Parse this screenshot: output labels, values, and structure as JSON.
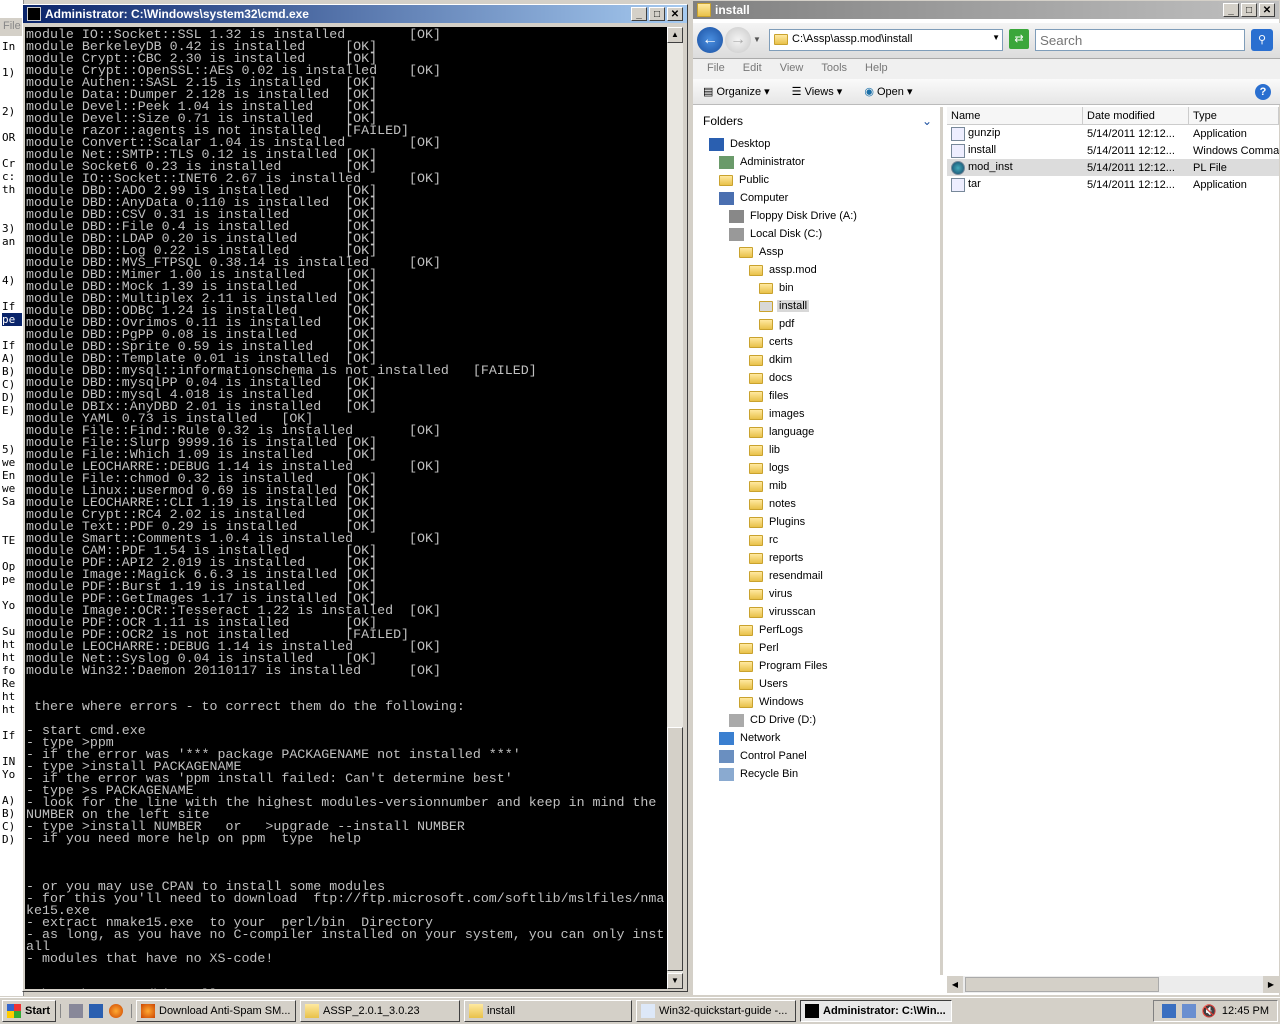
{
  "notepad": {
    "menu": "File",
    "lines": [
      "In",
      "",
      "1)",
      "",
      "",
      "2)",
      "",
      "OR",
      "",
      "Cr",
      "c:",
      "th",
      "",
      "",
      "3)",
      "an",
      "",
      "",
      "4)",
      "",
      "If",
      "pe",
      "",
      "If",
      "A)",
      "B)",
      "C)",
      "D)",
      "E)",
      "",
      "",
      "5)",
      "we",
      "En",
      "we",
      "Sa",
      "",
      "",
      "TE",
      "",
      "Op",
      "pe",
      "",
      "Yo",
      "",
      "Su",
      "ht",
      "ht",
      "fo",
      "Re",
      "ht",
      "ht",
      "",
      "If",
      "",
      "IN",
      "Yo",
      "",
      "A)",
      "B)",
      "C)",
      "D)"
    ],
    "selected_index": 21
  },
  "cmd": {
    "title": "Administrator: C:\\Windows\\system32\\cmd.exe",
    "lines": [
      "module IO::Socket::SSL 1.32 is installed\t[OK]",
      "module BerkeleyDB 0.42 is installed\t[OK]",
      "module Crypt::CBC 2.30 is installed\t[OK]",
      "module Crypt::OpenSSL::AES 0.02 is installed\t[OK]",
      "module Authen::SASL 2.15 is installed\t[OK]",
      "module Data::Dumper 2.128 is installed\t[OK]",
      "module Devel::Peek 1.04 is installed\t[OK]",
      "module Devel::Size 0.71 is installed\t[OK]",
      "module razor::agents is not installed\t[FAILED]",
      "module Convert::Scalar 1.04 is installed\t[OK]",
      "module Net::SMTP::TLS 0.12 is installed\t[OK]",
      "module Socket6 0.23 is installed\t[OK]",
      "module IO::Socket::INET6 2.67 is installed\t[OK]",
      "module DBD::ADO 2.99 is installed\t[OK]",
      "module DBD::AnyData 0.110 is installed\t[OK]",
      "module DBD::CSV 0.31 is installed\t[OK]",
      "module DBD::File 0.4 is installed\t[OK]",
      "module DBD::LDAP 0.20 is installed\t[OK]",
      "module DBD::Log 0.22 is installed\t[OK]",
      "module DBD::MVS_FTPSQL 0.38.14 is installed\t[OK]",
      "module DBD::Mimer 1.00 is installed\t[OK]",
      "module DBD::Mock 1.39 is installed\t[OK]",
      "module DBD::Multiplex 2.11 is installed\t[OK]",
      "module DBD::ODBC 1.24 is installed\t[OK]",
      "module DBD::Ovrimos 0.11 is installed\t[OK]",
      "module DBD::PgPP 0.08 is installed\t[OK]",
      "module DBD::Sprite 0.59 is installed\t[OK]",
      "module DBD::Template 0.01 is installed\t[OK]",
      "module DBD::mysql::informationschema is not installed\t[FAILED]",
      "module DBD::mysqlPP 0.04 is installed\t[OK]",
      "module DBD::mysql 4.018 is installed\t[OK]",
      "module DBIx::AnyDBD 2.01 is installed\t[OK]",
      "module YAML 0.73 is installed\t[OK]",
      "module File::Find::Rule 0.32 is installed\t[OK]",
      "module File::Slurp 9999.16 is installed\t[OK]",
      "module File::Which 1.09 is installed\t[OK]",
      "module LEOCHARRE::DEBUG 1.14 is installed\t[OK]",
      "module File::chmod 0.32 is installed\t[OK]",
      "module Linux::usermod 0.69 is installed\t[OK]",
      "module LEOCHARRE::CLI 1.19 is installed\t[OK]",
      "module Crypt::RC4 2.02 is installed\t[OK]",
      "module Text::PDF 0.29 is installed\t[OK]",
      "module Smart::Comments 1.0.4 is installed\t[OK]",
      "module CAM::PDF 1.54 is installed\t[OK]",
      "module PDF::API2 2.019 is installed\t[OK]",
      "module Image::Magick 6.6.3 is installed\t[OK]",
      "module PDF::Burst 1.19 is installed\t[OK]",
      "module PDF::GetImages 1.17 is installed\t[OK]",
      "module Image::OCR::Tesseract 1.22 is installed\t[OK]",
      "module PDF::OCR 1.11 is installed\t[OK]",
      "module PDF::OCR2 is not installed\t[FAILED]",
      "module LEOCHARRE::DEBUG 1.14 is installed\t[OK]",
      "module Net::Syslog 0.04 is installed\t[OK]",
      "module Win32::Daemon 20110117 is installed\t[OK]",
      "",
      "",
      " there where errors - to correct them do the following:",
      "",
      "- start cmd.exe",
      "- type >ppm",
      "- if the error was '*** package PACKAGENAME not installed ***'",
      "- type >install PACKAGENAME",
      "- if the error was 'ppm install failed: Can't determine best'",
      "- type >s PACKAGENAME",
      "- look for the line with the highest modules-versionnumber and keep in mind the",
      "NUMBER on the left site",
      "- type >install NUMBER   or   >upgrade --install NUMBER",
      "- if you need more help on ppm  type  help",
      "",
      "",
      "",
      "- or you may use CPAN to install some modules",
      "- for this you'll need to download  ftp://ftp.microsoft.com/softlib/mslfiles/nma",
      "ke15.exe",
      "- extract nmake15.exe  to your  perl/bin  Directory",
      "- as long, as you have no C-compiler installed on your system, you can only inst",
      "all",
      "- modules that have no XS-code!",
      "",
      "",
      "C:\\Assp\\assp.mod\\install>_"
    ]
  },
  "explorer": {
    "title": "install",
    "address": "C:\\Assp\\assp.mod\\install",
    "search_placeholder": "Search",
    "menu": [
      "File",
      "Edit",
      "View",
      "Tools",
      "Help"
    ],
    "toolbar": {
      "organize": "Organize",
      "views": "Views",
      "open": "Open"
    },
    "folders_label": "Folders",
    "tree": [
      {
        "label": "Desktop",
        "level": 0,
        "icon": "desktop-icon"
      },
      {
        "label": "Administrator",
        "level": 1,
        "icon": "user-folder-icon"
      },
      {
        "label": "Public",
        "level": 1,
        "icon": "folder-icon"
      },
      {
        "label": "Computer",
        "level": 1,
        "icon": "computer-icon"
      },
      {
        "label": "Floppy Disk Drive (A:)",
        "level": 2,
        "icon": "floppy-icon"
      },
      {
        "label": "Local Disk (C:)",
        "level": 2,
        "icon": "disk-icon"
      },
      {
        "label": "Assp",
        "level": 3,
        "icon": "folder-icon"
      },
      {
        "label": "assp.mod",
        "level": 4,
        "icon": "folder-icon"
      },
      {
        "label": "bin",
        "level": 5,
        "icon": "folder-icon"
      },
      {
        "label": "install",
        "level": 5,
        "icon": "folder-icon",
        "selected": true
      },
      {
        "label": "pdf",
        "level": 5,
        "icon": "folder-icon"
      },
      {
        "label": "certs",
        "level": 4,
        "icon": "folder-icon"
      },
      {
        "label": "dkim",
        "level": 4,
        "icon": "folder-icon"
      },
      {
        "label": "docs",
        "level": 4,
        "icon": "folder-icon"
      },
      {
        "label": "files",
        "level": 4,
        "icon": "folder-icon"
      },
      {
        "label": "images",
        "level": 4,
        "icon": "folder-icon"
      },
      {
        "label": "language",
        "level": 4,
        "icon": "folder-icon"
      },
      {
        "label": "lib",
        "level": 4,
        "icon": "folder-icon"
      },
      {
        "label": "logs",
        "level": 4,
        "icon": "folder-icon"
      },
      {
        "label": "mib",
        "level": 4,
        "icon": "folder-icon"
      },
      {
        "label": "notes",
        "level": 4,
        "icon": "folder-icon"
      },
      {
        "label": "Plugins",
        "level": 4,
        "icon": "folder-icon"
      },
      {
        "label": "rc",
        "level": 4,
        "icon": "folder-icon"
      },
      {
        "label": "reports",
        "level": 4,
        "icon": "folder-icon"
      },
      {
        "label": "resendmail",
        "level": 4,
        "icon": "folder-icon"
      },
      {
        "label": "virus",
        "level": 4,
        "icon": "folder-icon"
      },
      {
        "label": "virusscan",
        "level": 4,
        "icon": "folder-icon"
      },
      {
        "label": "PerfLogs",
        "level": 3,
        "icon": "folder-icon"
      },
      {
        "label": "Perl",
        "level": 3,
        "icon": "folder-icon"
      },
      {
        "label": "Program Files",
        "level": 3,
        "icon": "folder-icon"
      },
      {
        "label": "Users",
        "level": 3,
        "icon": "folder-icon"
      },
      {
        "label": "Windows",
        "level": 3,
        "icon": "folder-icon"
      },
      {
        "label": "CD Drive (D:)",
        "level": 2,
        "icon": "cd-icon"
      },
      {
        "label": "Network",
        "level": 1,
        "icon": "network-icon"
      },
      {
        "label": "Control Panel",
        "level": 1,
        "icon": "control-panel-icon"
      },
      {
        "label": "Recycle Bin",
        "level": 1,
        "icon": "recycle-bin-icon"
      }
    ],
    "columns": [
      "Name",
      "Date modified",
      "Type"
    ],
    "files": [
      {
        "name": "gunzip",
        "date": "5/14/2011 12:12...",
        "type": "Application"
      },
      {
        "name": "install",
        "date": "5/14/2011 12:12...",
        "type": "Windows Comma"
      },
      {
        "name": "mod_inst",
        "date": "5/14/2011 12:12...",
        "type": "PL File",
        "selected": true
      },
      {
        "name": "tar",
        "date": "5/14/2011 12:12...",
        "type": "Application"
      }
    ]
  },
  "taskbar": {
    "start": "Start",
    "items": [
      {
        "label": "Download Anti-Spam SM...",
        "icon": "firefox-icon"
      },
      {
        "label": "ASSP_2.0.1_3.0.23",
        "icon": "folder-icon"
      },
      {
        "label": "install",
        "icon": "folder-icon"
      },
      {
        "label": "Win32-quickstart-guide -...",
        "icon": "notepad-icon"
      },
      {
        "label": "Administrator: C:\\Win...",
        "icon": "cmd-icon",
        "active": true
      }
    ],
    "clock": "12:45 PM"
  }
}
